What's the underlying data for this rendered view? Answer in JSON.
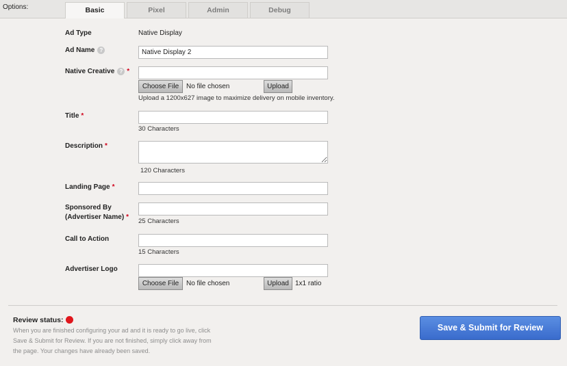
{
  "options_label": "Options:",
  "tabs": [
    {
      "label": "Basic",
      "active": true
    },
    {
      "label": "Pixel",
      "active": false
    },
    {
      "label": "Admin",
      "active": false
    },
    {
      "label": "Debug",
      "active": false
    }
  ],
  "required_mark": "*",
  "help_glyph": "?",
  "form": {
    "ad_type": {
      "label": "Ad Type",
      "value": "Native Display"
    },
    "ad_name": {
      "label": "Ad Name",
      "value": "Native Display 2"
    },
    "native_creative": {
      "label": "Native Creative",
      "choose_file": "Choose File",
      "no_file": "No file chosen",
      "upload": "Upload",
      "hint": "Upload a 1200x627 image to maximize delivery on mobile inventory."
    },
    "title": {
      "label": "Title",
      "value": "",
      "hint": "30 Characters"
    },
    "description": {
      "label": "Description",
      "value": "",
      "hint": "120 Characters"
    },
    "landing_page": {
      "label": "Landing Page",
      "value": ""
    },
    "sponsored_by": {
      "label_line1": "Sponsored By",
      "label_line2": "(Advertiser Name)",
      "value": "",
      "hint": "25 Characters"
    },
    "call_to_action": {
      "label": "Call to Action",
      "value": "",
      "hint": "15 Characters"
    },
    "advertiser_logo": {
      "label": "Advertiser Logo",
      "choose_file": "Choose File",
      "no_file": "No file chosen",
      "upload": "Upload",
      "ratio": "1x1 ratio"
    }
  },
  "review": {
    "title": "Review status:",
    "status_color": "#e0161c",
    "description": "When you are finished configuring your ad and it is ready to go live, click Save & Submit for Review. If you are not finished, simply click away from the page. Your changes have already been saved.",
    "submit_label": "Save & Submit for Review"
  },
  "colors": {
    "accent": "#3f71d0",
    "required": "#d0021b"
  }
}
